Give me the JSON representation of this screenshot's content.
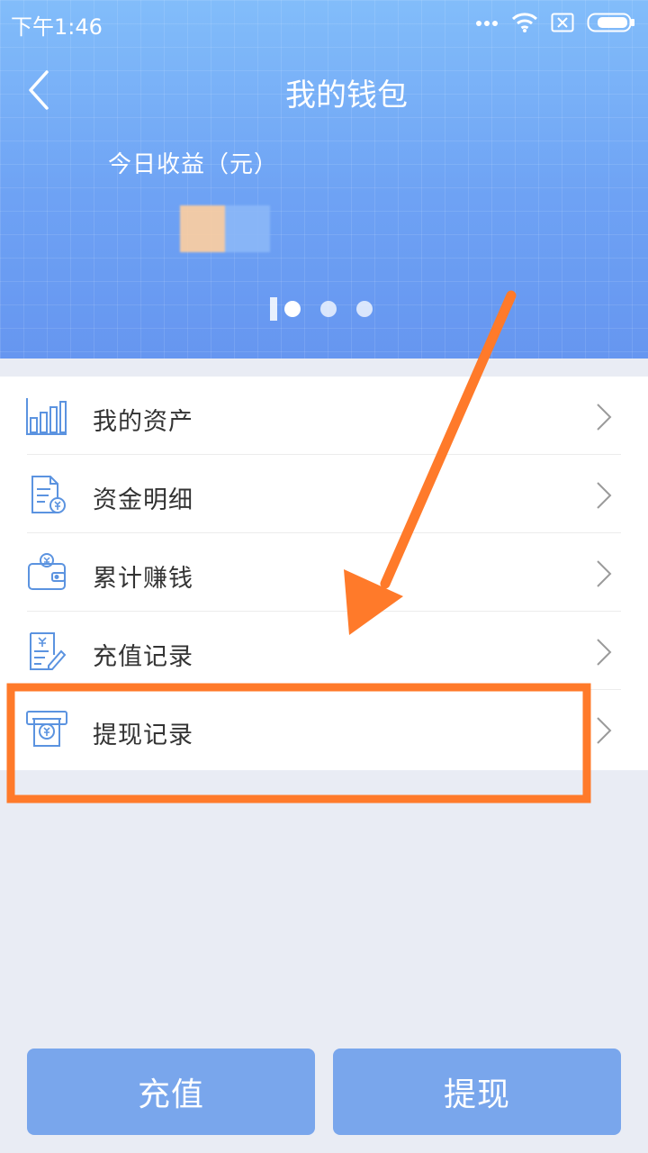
{
  "status_bar": {
    "time": "下午1:46"
  },
  "header": {
    "title": "我的钱包",
    "earnings_label": "今日收益（元）"
  },
  "menu": [
    {
      "label": "我的资产",
      "icon": "bar-chart-icon"
    },
    {
      "label": "资金明细",
      "icon": "document-yuan-icon"
    },
    {
      "label": "累计赚钱",
      "icon": "wallet-icon"
    },
    {
      "label": "充值记录",
      "icon": "edit-record-icon"
    },
    {
      "label": "提现记录",
      "icon": "atm-withdraw-icon"
    }
  ],
  "buttons": {
    "recharge": "充值",
    "withdraw": "提现"
  },
  "colors": {
    "header_top": "#82bdfa",
    "header_bottom": "#6696f0",
    "icon_blue": "#5b93e0",
    "button_bg": "#79a6ec",
    "annotation_orange": "#ff7a2a",
    "page_bg": "#e9ecf4"
  }
}
